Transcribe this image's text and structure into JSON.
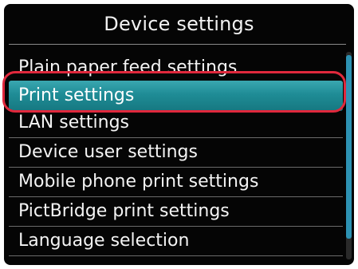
{
  "screen": {
    "title": "Device settings"
  },
  "menu": {
    "items": [
      {
        "label": "Plain paper feed settings"
      },
      {
        "label": "Print settings",
        "selected": true
      },
      {
        "label": "LAN settings"
      },
      {
        "label": "Device user settings"
      },
      {
        "label": "Mobile phone print settings"
      },
      {
        "label": "PictBridge print settings"
      },
      {
        "label": "Language selection"
      }
    ]
  },
  "scroll": {
    "position": 0.0,
    "visible_fraction": 0.9
  },
  "colors": {
    "background": "#050505",
    "text": "#f4f4f4",
    "selection": "#1f8c96",
    "highlight_ring": "#e0283c",
    "scrollbar": "#2d92b3"
  }
}
